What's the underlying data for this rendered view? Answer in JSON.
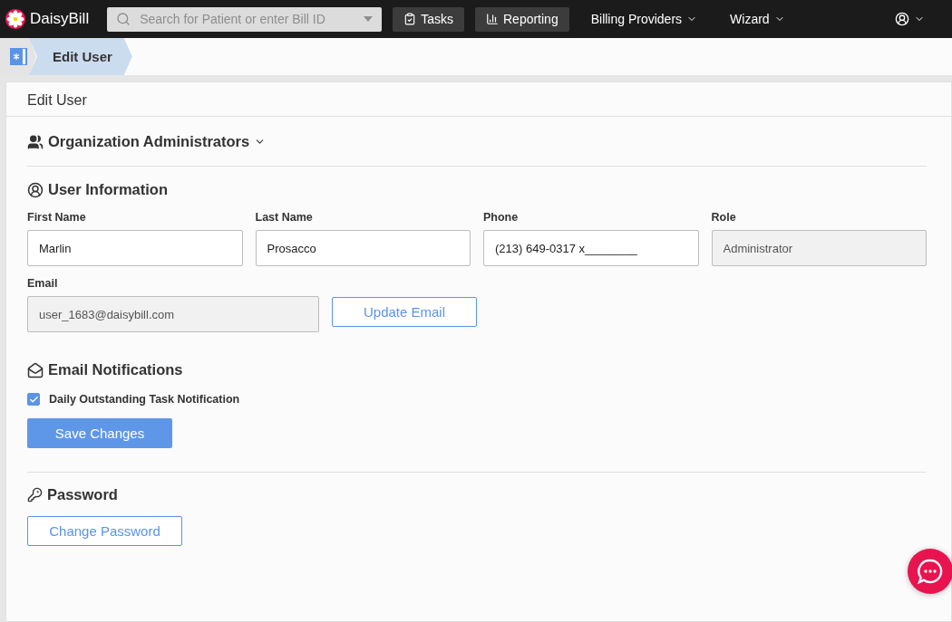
{
  "navbar": {
    "brand": "DaisyBill",
    "search": {
      "placeholder": "Search for Patient or enter Bill ID"
    },
    "items": [
      {
        "label": "Tasks",
        "kind": "button"
      },
      {
        "label": "Reporting",
        "kind": "button"
      },
      {
        "label": "Billing Providers",
        "kind": "dropdown"
      },
      {
        "label": "Wizard",
        "kind": "dropdown"
      }
    ]
  },
  "breadcrumb": {
    "label": "Edit User"
  },
  "card": {
    "title": "Edit User",
    "admins": {
      "label": "Organization Administrators",
      "expanded": false
    },
    "user_info": {
      "heading": "User Information",
      "fields": [
        {
          "label": "First Name",
          "value": "Marlin",
          "disabled": false
        },
        {
          "label": "Last Name",
          "value": "Prosacco",
          "disabled": false
        },
        {
          "label": "Phone",
          "value": "(213) 649-0317 x________",
          "disabled": false
        },
        {
          "label": "Role",
          "value": "Administrator",
          "disabled": true
        }
      ],
      "email": {
        "label": "Email",
        "value": "user_1683@daisybill.com",
        "disabled": true
      },
      "update_button": "Update Email"
    },
    "notifications": {
      "heading": "Email Notifications",
      "options": [
        {
          "label": "Daily Outstanding Task Notification",
          "checked": true
        }
      ],
      "save_button": "Save Changes"
    },
    "password": {
      "heading": "Password",
      "button": "Change Password"
    }
  }
}
